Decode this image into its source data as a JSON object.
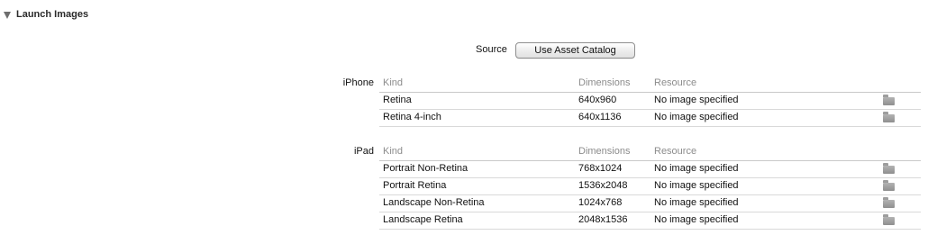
{
  "section": {
    "title": "Launch Images"
  },
  "source": {
    "label": "Source",
    "button_label": "Use Asset Catalog"
  },
  "iphone": {
    "label": "iPhone",
    "columns": [
      "Kind",
      "Dimensions",
      "Resource"
    ],
    "rows": [
      {
        "kind": "Retina",
        "dimensions": "640x960",
        "resource": "No image specified",
        "icon": "folder-icon"
      },
      {
        "kind": "Retina 4-inch",
        "dimensions": "640x1136",
        "resource": "No image specified",
        "icon": "folder-icon"
      }
    ]
  },
  "ipad": {
    "label": "iPad",
    "columns": [
      "Kind",
      "Dimensions",
      "Resource"
    ],
    "rows": [
      {
        "kind": "Portrait Non-Retina",
        "dimensions": "768x1024",
        "resource": "No image specified",
        "icon": "folder-icon"
      },
      {
        "kind": "Portrait Retina",
        "dimensions": "1536x2048",
        "resource": "No image specified",
        "icon": "folder-icon"
      },
      {
        "kind": "Landscape Non-Retina",
        "dimensions": "1024x768",
        "resource": "No image specified",
        "icon": "folder-icon"
      },
      {
        "kind": "Landscape Retina",
        "dimensions": "2048x1536",
        "resource": "No image specified",
        "icon": "folder-icon"
      }
    ]
  }
}
